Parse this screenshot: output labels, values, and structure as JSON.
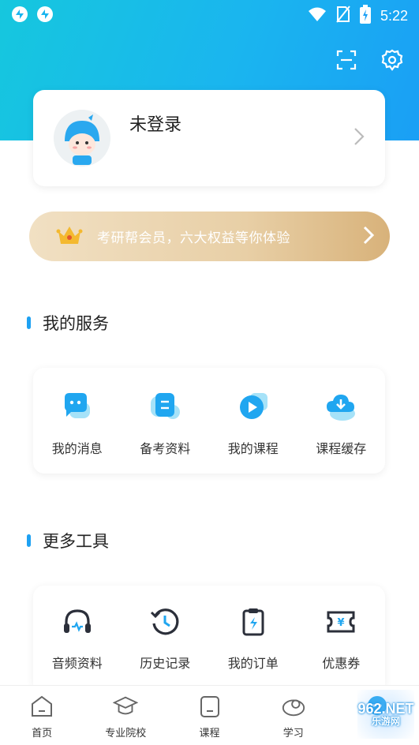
{
  "status_bar": {
    "time": "5:22"
  },
  "profile": {
    "name": "未登录"
  },
  "vip": {
    "text": "考研帮会员，六大权益等你体验"
  },
  "services": {
    "title": "我的服务",
    "items": [
      {
        "label": "我的消息",
        "icon": "message-icon"
      },
      {
        "label": "备考资料",
        "icon": "document-icon"
      },
      {
        "label": "我的课程",
        "icon": "play-icon"
      },
      {
        "label": "课程缓存",
        "icon": "cloud-download-icon"
      }
    ]
  },
  "tools": {
    "title": "更多工具",
    "items": [
      {
        "label": "音频资料",
        "icon": "headphones-icon"
      },
      {
        "label": "历史记录",
        "icon": "history-icon"
      },
      {
        "label": "我的订单",
        "icon": "order-icon"
      },
      {
        "label": "优惠券",
        "icon": "coupon-icon"
      }
    ]
  },
  "bottom_nav": {
    "items": [
      {
        "label": "首页",
        "icon": "home-icon"
      },
      {
        "label": "专业院校",
        "icon": "graduation-cap-icon"
      },
      {
        "label": "课程",
        "icon": "course-icon"
      },
      {
        "label": "学习",
        "icon": "study-icon"
      }
    ]
  },
  "watermark": {
    "text": "962.NET",
    "subtext": "乐游网"
  },
  "colors": {
    "header_start": "#16c7de",
    "header_end": "#1a9ff5",
    "accent": "#1ea1f2",
    "vip_gold": "#d8b27a"
  }
}
